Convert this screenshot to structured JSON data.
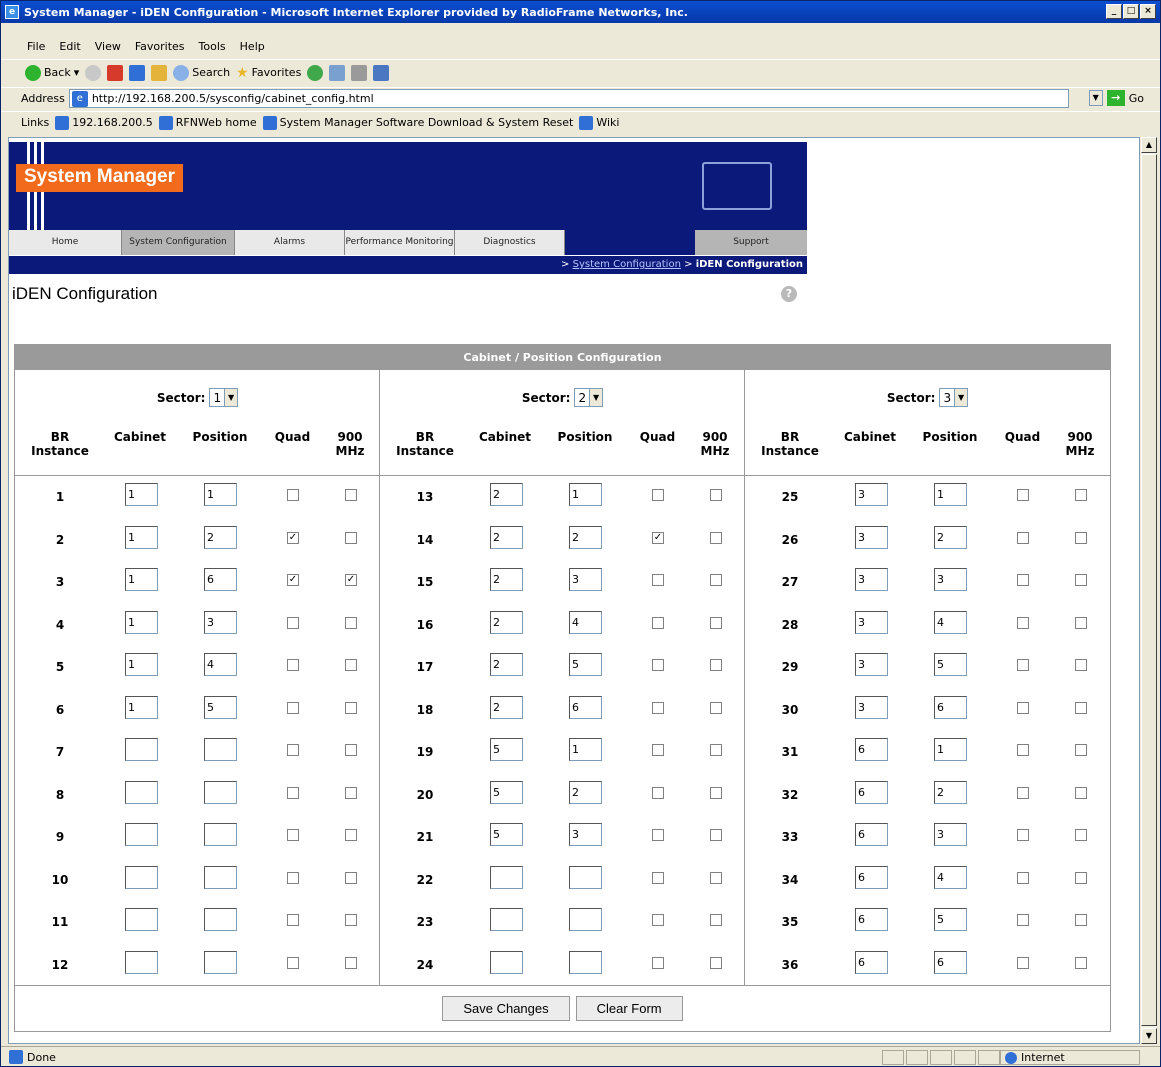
{
  "window": {
    "title": "System Manager - iDEN Configuration - Microsoft Internet Explorer provided by RadioFrame Networks, Inc."
  },
  "menu": [
    "File",
    "Edit",
    "View",
    "Favorites",
    "Tools",
    "Help"
  ],
  "toolbar": {
    "back": "Back",
    "search": "Search",
    "favorites": "Favorites"
  },
  "address": {
    "label": "Address",
    "url": "http://192.168.200.5/sysconfig/cabinet_config.html",
    "go": "Go"
  },
  "links": {
    "label": "Links",
    "items": [
      "192.168.200.5",
      "RFNWeb home",
      "System Manager Software Download & System Reset",
      "Wiki"
    ]
  },
  "banner": {
    "logo": "System Manager"
  },
  "nav": [
    "Home",
    "System Configuration",
    "Alarms",
    "Performance Monitoring",
    "Diagnostics",
    "",
    "Support"
  ],
  "breadcrumb": {
    "prefix": ">",
    "link": "System Configuration",
    "sep": ">",
    "current": "iDEN Configuration"
  },
  "page": {
    "title": "iDEN Configuration"
  },
  "panel": {
    "title": "Cabinet / Position Configuration"
  },
  "headers": {
    "instance": "BR Instance",
    "cabinet": "Cabinet",
    "position": "Position",
    "quad": "Quad",
    "mhz": "900 MHz"
  },
  "sectors": [
    {
      "label": "Sector:",
      "value": "1",
      "rows": [
        {
          "n": "1",
          "cab": "1",
          "pos": "1",
          "quad": false,
          "mhz": false
        },
        {
          "n": "2",
          "cab": "1",
          "pos": "2",
          "quad": true,
          "mhz": false
        },
        {
          "n": "3",
          "cab": "1",
          "pos": "6",
          "quad": true,
          "mhz": true
        },
        {
          "n": "4",
          "cab": "1",
          "pos": "3",
          "quad": false,
          "mhz": false
        },
        {
          "n": "5",
          "cab": "1",
          "pos": "4",
          "quad": false,
          "mhz": false
        },
        {
          "n": "6",
          "cab": "1",
          "pos": "5",
          "quad": false,
          "mhz": false
        },
        {
          "n": "7",
          "cab": "",
          "pos": "",
          "quad": false,
          "mhz": false
        },
        {
          "n": "8",
          "cab": "",
          "pos": "",
          "quad": false,
          "mhz": false
        },
        {
          "n": "9",
          "cab": "",
          "pos": "",
          "quad": false,
          "mhz": false
        },
        {
          "n": "10",
          "cab": "",
          "pos": "",
          "quad": false,
          "mhz": false
        },
        {
          "n": "11",
          "cab": "",
          "pos": "",
          "quad": false,
          "mhz": false
        },
        {
          "n": "12",
          "cab": "",
          "pos": "",
          "quad": false,
          "mhz": false
        }
      ]
    },
    {
      "label": "Sector:",
      "value": "2",
      "rows": [
        {
          "n": "13",
          "cab": "2",
          "pos": "1",
          "quad": false,
          "mhz": false
        },
        {
          "n": "14",
          "cab": "2",
          "pos": "2",
          "quad": true,
          "mhz": false
        },
        {
          "n": "15",
          "cab": "2",
          "pos": "3",
          "quad": false,
          "mhz": false
        },
        {
          "n": "16",
          "cab": "2",
          "pos": "4",
          "quad": false,
          "mhz": false
        },
        {
          "n": "17",
          "cab": "2",
          "pos": "5",
          "quad": false,
          "mhz": false
        },
        {
          "n": "18",
          "cab": "2",
          "pos": "6",
          "quad": false,
          "mhz": false
        },
        {
          "n": "19",
          "cab": "5",
          "pos": "1",
          "quad": false,
          "mhz": false
        },
        {
          "n": "20",
          "cab": "5",
          "pos": "2",
          "quad": false,
          "mhz": false
        },
        {
          "n": "21",
          "cab": "5",
          "pos": "3",
          "quad": false,
          "mhz": false
        },
        {
          "n": "22",
          "cab": "",
          "pos": "",
          "quad": false,
          "mhz": false
        },
        {
          "n": "23",
          "cab": "",
          "pos": "",
          "quad": false,
          "mhz": false
        },
        {
          "n": "24",
          "cab": "",
          "pos": "",
          "quad": false,
          "mhz": false
        }
      ]
    },
    {
      "label": "Sector:",
      "value": "3",
      "rows": [
        {
          "n": "25",
          "cab": "3",
          "pos": "1",
          "quad": false,
          "mhz": false
        },
        {
          "n": "26",
          "cab": "3",
          "pos": "2",
          "quad": false,
          "mhz": false
        },
        {
          "n": "27",
          "cab": "3",
          "pos": "3",
          "quad": false,
          "mhz": false
        },
        {
          "n": "28",
          "cab": "3",
          "pos": "4",
          "quad": false,
          "mhz": false
        },
        {
          "n": "29",
          "cab": "3",
          "pos": "5",
          "quad": false,
          "mhz": false
        },
        {
          "n": "30",
          "cab": "3",
          "pos": "6",
          "quad": false,
          "mhz": false
        },
        {
          "n": "31",
          "cab": "6",
          "pos": "1",
          "quad": false,
          "mhz": false
        },
        {
          "n": "32",
          "cab": "6",
          "pos": "2",
          "quad": false,
          "mhz": false
        },
        {
          "n": "33",
          "cab": "6",
          "pos": "3",
          "quad": false,
          "mhz": false
        },
        {
          "n": "34",
          "cab": "6",
          "pos": "4",
          "quad": false,
          "mhz": false
        },
        {
          "n": "35",
          "cab": "6",
          "pos": "5",
          "quad": false,
          "mhz": false
        },
        {
          "n": "36",
          "cab": "6",
          "pos": "6",
          "quad": false,
          "mhz": false
        }
      ]
    }
  ],
  "buttons": {
    "save": "Save Changes",
    "clear": "Clear Form"
  },
  "status": {
    "text": "Done",
    "zone": "Internet"
  },
  "colors": {
    "banner": "#0b1a7a",
    "logo": "#f26a1b",
    "panelHeader": "#9a9a9a"
  }
}
